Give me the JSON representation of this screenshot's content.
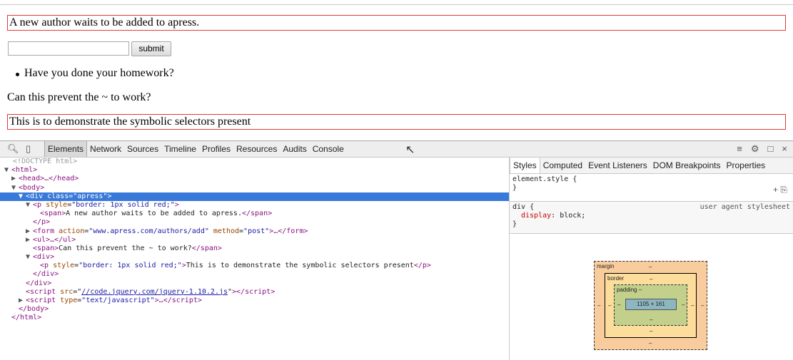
{
  "page": {
    "p1_text": "A new author waits to be added to apress.",
    "input_value": "",
    "submit_label": "submit",
    "list_item": "Have you done your homework?",
    "span_text": "Can this prevent the ~ to work?",
    "p2_text": "This is to demonstrate the symbolic selectors present"
  },
  "devtools": {
    "tabs": [
      "Elements",
      "Network",
      "Sources",
      "Timeline",
      "Profiles",
      "Resources",
      "Audits",
      "Console"
    ],
    "active_tab": "Elements",
    "dom_lines": {
      "doctype": "<!DOCTYPE html>",
      "html_open": "<html>",
      "head": "<head>…</head>",
      "body_open": "<body>",
      "div_tag": "div",
      "div_attr": "class",
      "div_val": "\"apress\"",
      "p_tag": "p",
      "p_attr": "style",
      "p_val": "\"border: 1px solid red;\"",
      "span1": "A new author waits to be added to apress.",
      "p_close": "</p>",
      "form_attr1": "action",
      "form_val1": "\"www.apress.com/authors/add\"",
      "form_attr2": "method",
      "form_val2": "\"post\"",
      "ul": "<ul>…</ul>",
      "span2": "Can this prevent the ~ to work?",
      "div2_open": "<div>",
      "p2_val": "\"border: 1px solid red;\"",
      "p2_text": "This is to demonstrate the symbolic selectors present",
      "div2_close": "</div>",
      "div_close": "</div>",
      "script_src": "//code.jquery.com/jquery-1.10.2.js",
      "script2_val": "\"text/javascript\"",
      "body_close": "</body>",
      "html_close": "</html>"
    },
    "side_tabs": [
      "Styles",
      "Computed",
      "Event Listeners",
      "DOM Breakpoints",
      "Properties"
    ],
    "element_style": "element.style {",
    "rule_selector": "div {",
    "rule_source": "user agent stylesheet",
    "rule_prop": "display",
    "rule_value": "block;",
    "close_brace": "}",
    "box_model": {
      "margin_label": "margin",
      "border_label": "border",
      "padding_label": "padding –",
      "content_size": "1105 × 161",
      "dash": "–"
    }
  }
}
